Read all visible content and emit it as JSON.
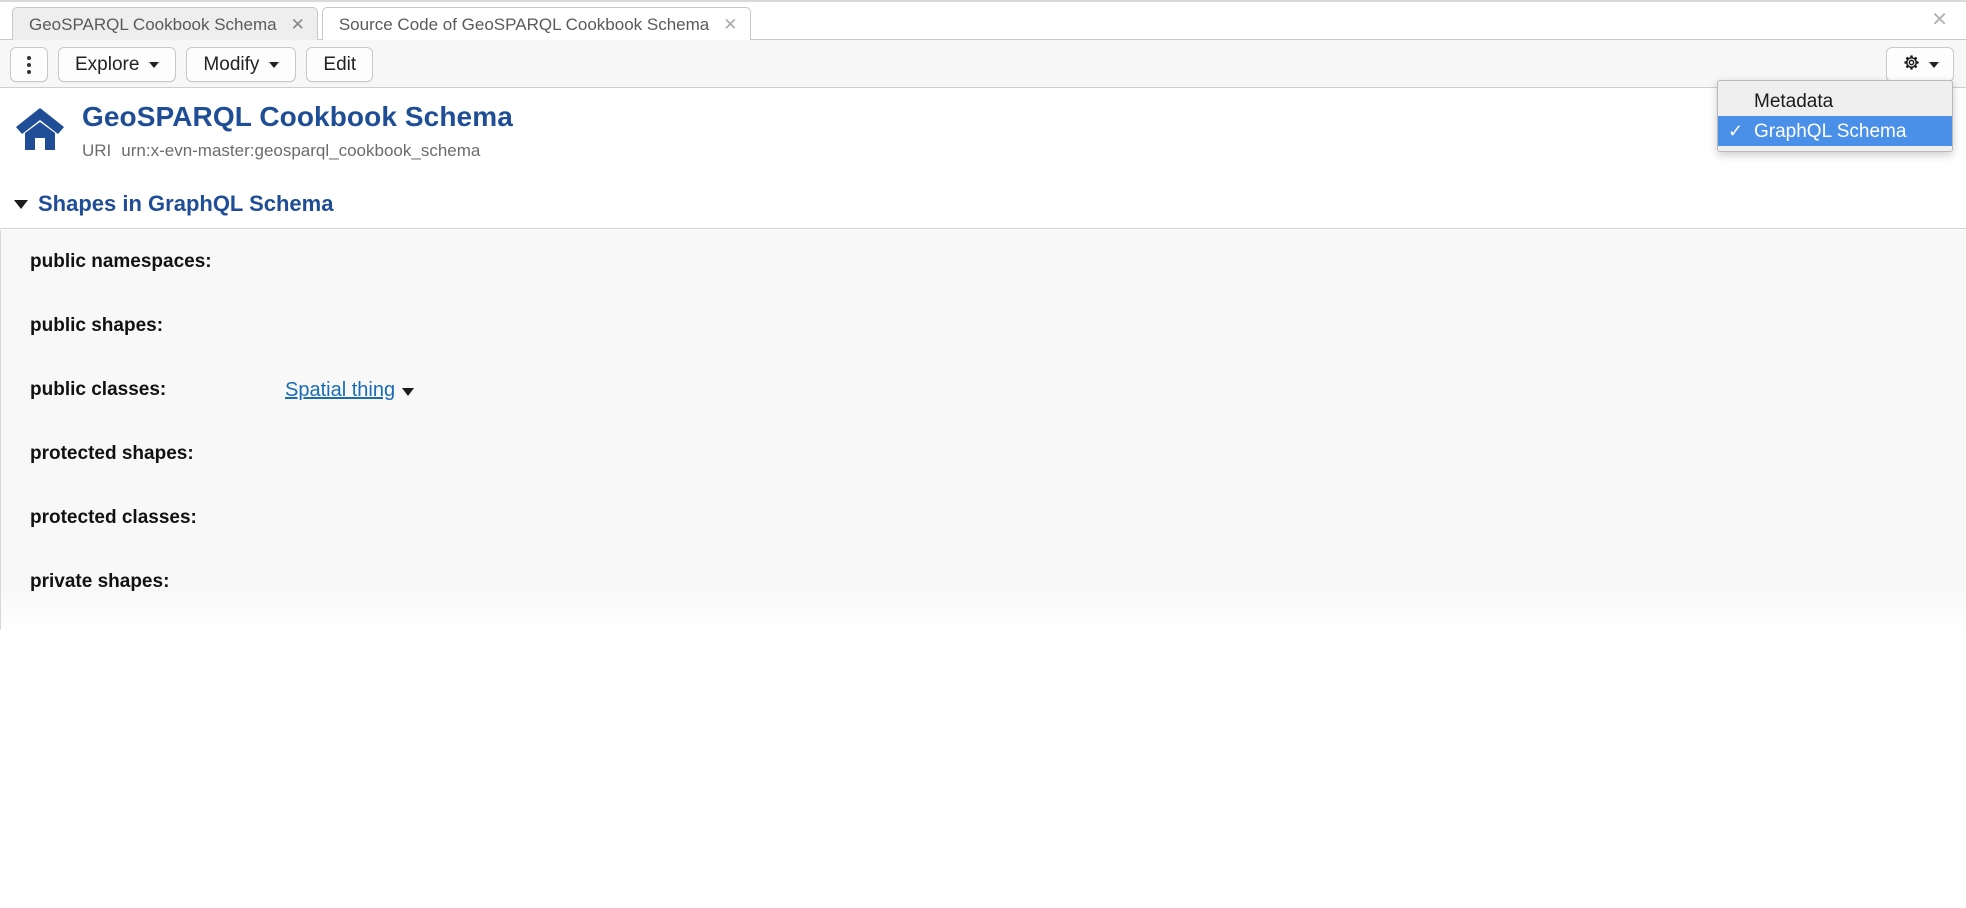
{
  "window": {
    "close_label": "✕"
  },
  "tabs": [
    {
      "label": "GeoSPARQL Cookbook Schema",
      "close": "✕",
      "state": "inactive"
    },
    {
      "label": "Source Code of GeoSPARQL Cookbook Schema",
      "close": "✕",
      "state": "active"
    }
  ],
  "toolbar": {
    "kebab_name": "more-options",
    "buttons": [
      {
        "label": "Explore",
        "has_caret": true
      },
      {
        "label": "Modify",
        "has_caret": true
      },
      {
        "label": "Edit",
        "has_caret": false
      }
    ],
    "gear": {
      "icon": "gear-icon",
      "has_caret": true
    }
  },
  "gear_menu": {
    "items": [
      {
        "label": "Metadata",
        "checked": false,
        "check_glyph": ""
      },
      {
        "label": "GraphQL Schema",
        "checked": true,
        "check_glyph": "✓"
      }
    ]
  },
  "header": {
    "icon": "home-icon",
    "title": "GeoSPARQL Cookbook Schema",
    "uri_label": "URI",
    "uri_value": "urn:x-evn-master:geosparql_cookbook_schema"
  },
  "section": {
    "expander": "triangle-down-icon",
    "title": "Shapes in GraphQL Schema"
  },
  "properties": [
    {
      "label": "public namespaces:",
      "value": "",
      "has_link": false
    },
    {
      "label": "public shapes:",
      "value": "",
      "has_link": false
    },
    {
      "label": "public classes:",
      "value": "Spatial thing",
      "has_link": true
    },
    {
      "label": "protected shapes:",
      "value": "",
      "has_link": false
    },
    {
      "label": "protected classes:",
      "value": "",
      "has_link": false
    },
    {
      "label": "private shapes:",
      "value": "",
      "has_link": false
    }
  ],
  "colors": {
    "brand_blue": "#1f4e96",
    "link_blue": "#1a6bb5",
    "menu_highlight": "#4a90e8",
    "panel_bg": "#f8f8f8"
  }
}
